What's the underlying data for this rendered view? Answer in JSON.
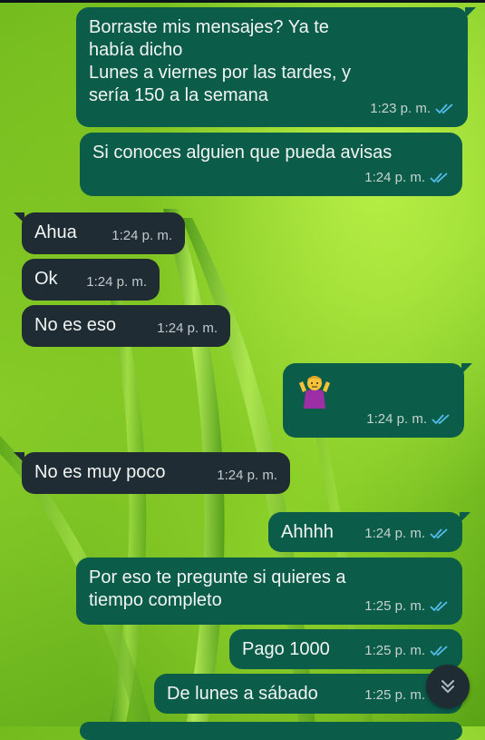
{
  "colors": {
    "outgoing_bubble": "#0c5c4a",
    "incoming_bubble": "#1f2c33",
    "read_ticks": "#53bdeb",
    "wallpaper_green": "#8bd02b"
  },
  "messages": [
    {
      "direction": "outgoing",
      "text": "Borraste mis mensajes? Ya te\nhabía dicho\nLunes a viernes por las tardes, y\nsería 150 a la semana",
      "time": "1:23 p. m.",
      "status": "read-icon"
    },
    {
      "direction": "outgoing",
      "text": "Si conoces alguien que pueda avisas",
      "time": "1:24 p. m.",
      "status": "read-icon"
    },
    {
      "direction": "incoming",
      "text": "Ahua",
      "time": "1:24 p. m."
    },
    {
      "direction": "incoming",
      "text": "Ok",
      "time": "1:24 p. m."
    },
    {
      "direction": "incoming",
      "text": "No es eso",
      "time": "1:24 p. m."
    },
    {
      "direction": "outgoing",
      "emoji": "person-shrugging-emoji",
      "time": "1:24 p. m.",
      "status": "read-icon"
    },
    {
      "direction": "incoming",
      "text": "No es muy poco",
      "time": "1:24 p. m."
    },
    {
      "direction": "outgoing",
      "text": "Ahhhh",
      "time": "1:24 p. m.",
      "status": "read-icon"
    },
    {
      "direction": "outgoing",
      "text": "Por eso te pregunte si quieres a\ntiempo completo",
      "time": "1:25 p. m.",
      "status": "read-icon"
    },
    {
      "direction": "outgoing",
      "text": "Pago 1000",
      "time": "1:25 p. m.",
      "status": "read-icon"
    },
    {
      "direction": "outgoing",
      "text": "De lunes a sábado",
      "time": "1:25 p. m.",
      "status": "read-icon"
    }
  ],
  "scroll_button_icon": "chevrons-down-icon"
}
